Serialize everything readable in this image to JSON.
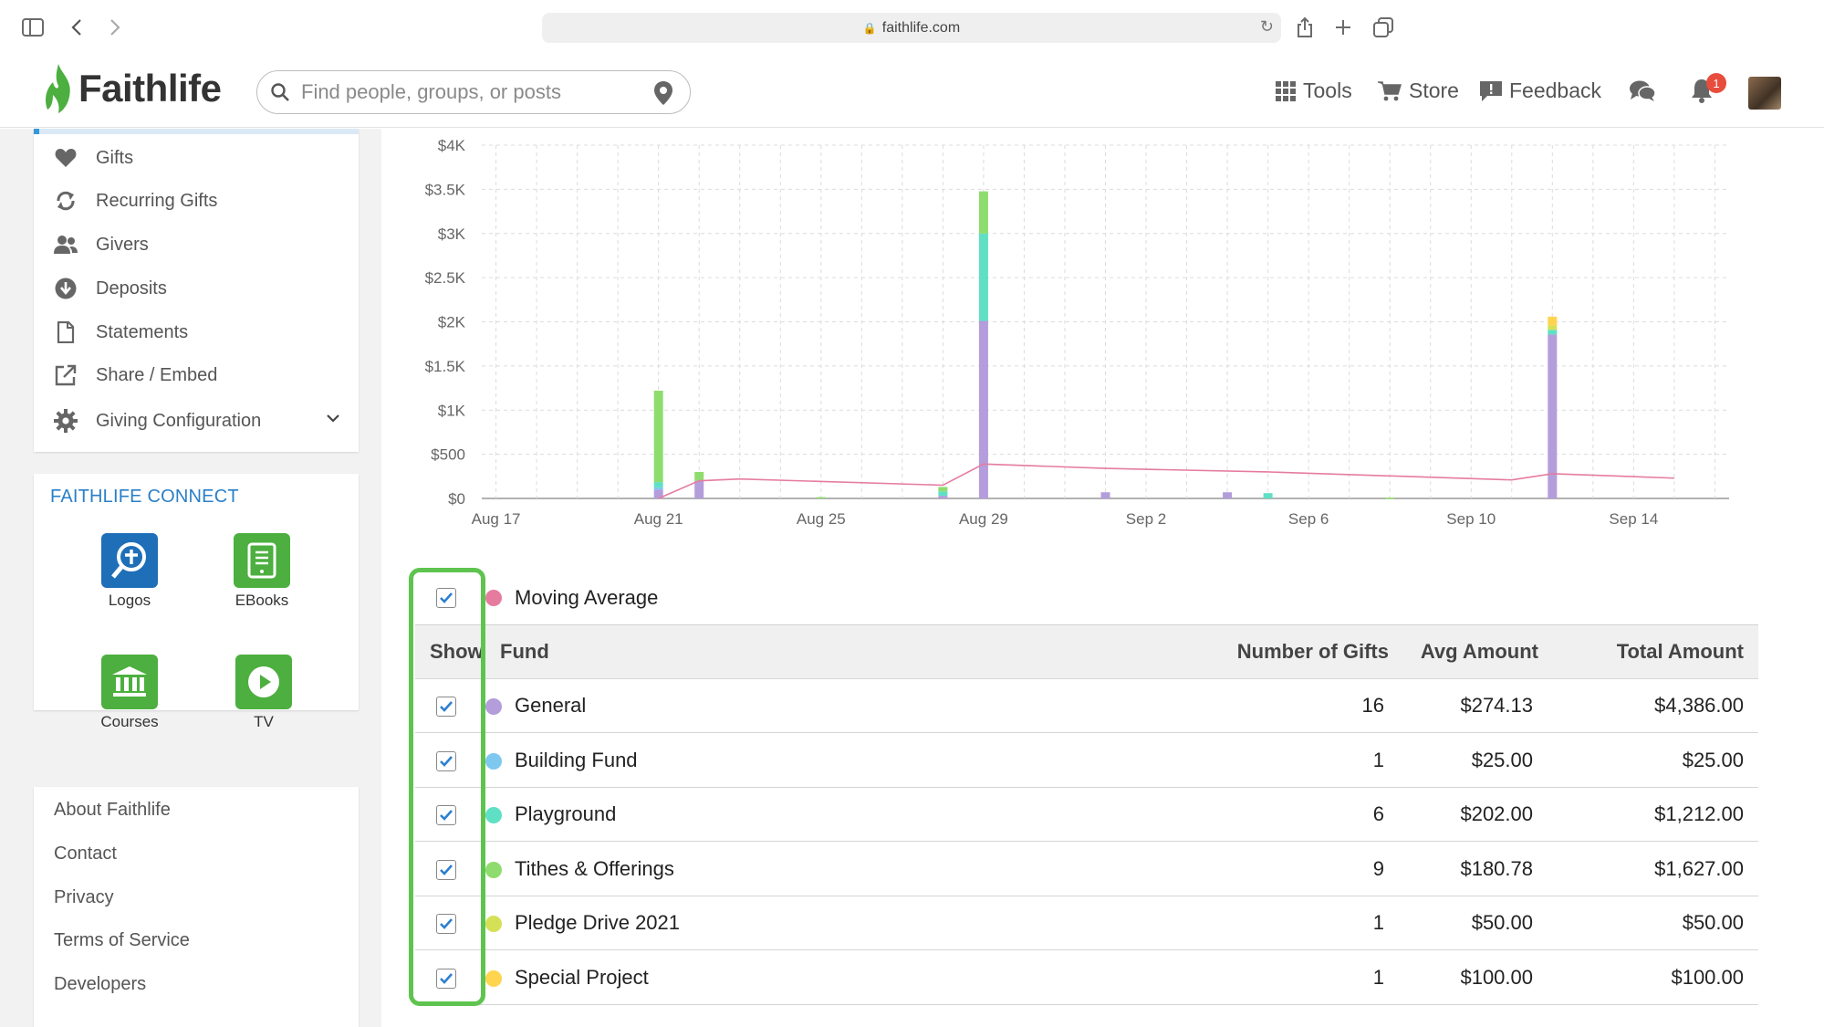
{
  "browser": {
    "url": "faithlife.com",
    "icons": [
      "sidebar-icon",
      "back-icon",
      "forward-icon",
      "reload-icon",
      "share-icon",
      "new-tab-icon",
      "tabs-icon"
    ]
  },
  "header": {
    "brand": "Faithlife",
    "search_placeholder": "Find people, groups, or posts",
    "nav": [
      {
        "label": "Tools",
        "icon": "grid-icon"
      },
      {
        "label": "Store",
        "icon": "cart-icon"
      },
      {
        "label": "Feedback",
        "icon": "feedback-icon"
      }
    ],
    "notification_count": "1"
  },
  "sidebar": {
    "items": [
      {
        "label": "Gifts",
        "icon": "heart-icon"
      },
      {
        "label": "Recurring Gifts",
        "icon": "refresh-icon"
      },
      {
        "label": "Givers",
        "icon": "users-icon"
      },
      {
        "label": "Deposits",
        "icon": "download-icon"
      },
      {
        "label": "Statements",
        "icon": "document-icon"
      },
      {
        "label": "Share / Embed",
        "icon": "external-link-icon"
      },
      {
        "label": "Giving Configuration",
        "icon": "gear-icon"
      }
    ],
    "connect_title": "FAITHLIFE CONNECT",
    "apps": [
      {
        "label": "Logos",
        "color": "#1e6fb8"
      },
      {
        "label": "EBooks",
        "color": "#4caf3f"
      },
      {
        "label": "Courses",
        "color": "#4caf3f"
      },
      {
        "label": "TV",
        "color": "#4caf3f"
      }
    ],
    "footer_links": [
      "About Faithlife",
      "Contact",
      "Privacy",
      "Terms of Service",
      "Developers"
    ]
  },
  "chart_data": {
    "type": "bar",
    "stacked": true,
    "x_ticks": [
      "Aug 17",
      "Aug 21",
      "Aug 25",
      "Aug 29",
      "Sep 2",
      "Sep 6",
      "Sep 10",
      "Sep 14"
    ],
    "y_ticks": [
      "$0",
      "$500",
      "$1K",
      "$1.5K",
      "$2K",
      "$2.5K",
      "$3K",
      "$3.5K",
      "$4K"
    ],
    "ylim": [
      0,
      4000
    ],
    "grid": true,
    "colors": {
      "General": "#b39ddb",
      "Building Fund": "#7ec8f0",
      "Playground": "#5fe0c4",
      "Tithes & Offerings": "#8fdc6e",
      "Pledge Drive 2021": "#d4e157",
      "Special Project": "#ffd54f",
      "Moving Average": "#e57ca0"
    },
    "bars": [
      {
        "day": "Aug 21",
        "General": 100,
        "Building Fund": 25,
        "Playground": 60,
        "Tithes & Offerings": 1035
      },
      {
        "day": "Aug 22",
        "General": 200,
        "Tithes & Offerings": 100
      },
      {
        "day": "Aug 25",
        "Tithes & Offerings": 15
      },
      {
        "day": "Aug 28",
        "General": 30,
        "Playground": 50,
        "Tithes & Offerings": 50
      },
      {
        "day": "Aug 29",
        "General": 2010,
        "Playground": 990,
        "Tithes & Offerings": 477
      },
      {
        "day": "Sep 1",
        "General": 70
      },
      {
        "day": "Sep 4",
        "General": 70
      },
      {
        "day": "Sep 5",
        "Playground": 60
      },
      {
        "day": "Sep 8",
        "Tithes & Offerings": 10
      },
      {
        "day": "Sep 12",
        "General": 1856,
        "Playground": 52,
        "Pledge Drive 2021": 50,
        "Special Project": 100
      }
    ],
    "moving_average": [
      {
        "day": "Aug 21",
        "value": 0
      },
      {
        "day": "Aug 22",
        "value": 200
      },
      {
        "day": "Aug 23",
        "value": 220
      },
      {
        "day": "Aug 28",
        "value": 150
      },
      {
        "day": "Aug 29",
        "value": 390
      },
      {
        "day": "Sep 1",
        "value": 340
      },
      {
        "day": "Sep 5",
        "value": 300
      },
      {
        "day": "Sep 11",
        "value": 210
      },
      {
        "day": "Sep 12",
        "value": 280
      },
      {
        "day": "Sep 15",
        "value": 230
      }
    ]
  },
  "legend": {
    "moving_average_label": "Moving Average",
    "moving_average_color": "#e57ca0"
  },
  "table": {
    "headers": {
      "show": "Show",
      "fund": "Fund",
      "count": "Number of Gifts",
      "avg": "Avg Amount",
      "total": "Total Amount"
    },
    "rows": [
      {
        "fund": "General",
        "color": "#b39ddb",
        "count": "16",
        "avg": "$274.13",
        "total": "$4,386.00"
      },
      {
        "fund": "Building Fund",
        "color": "#7ec8f0",
        "count": "1",
        "avg": "$25.00",
        "total": "$25.00"
      },
      {
        "fund": "Playground",
        "color": "#5fe0c4",
        "count": "6",
        "avg": "$202.00",
        "total": "$1,212.00"
      },
      {
        "fund": "Tithes & Offerings",
        "color": "#8fdc6e",
        "count": "9",
        "avg": "$180.78",
        "total": "$1,627.00"
      },
      {
        "fund": "Pledge Drive 2021",
        "color": "#d4e157",
        "count": "1",
        "avg": "$50.00",
        "total": "$50.00"
      },
      {
        "fund": "Special Project",
        "color": "#ffd54f",
        "count": "1",
        "avg": "$100.00",
        "total": "$100.00"
      }
    ]
  }
}
